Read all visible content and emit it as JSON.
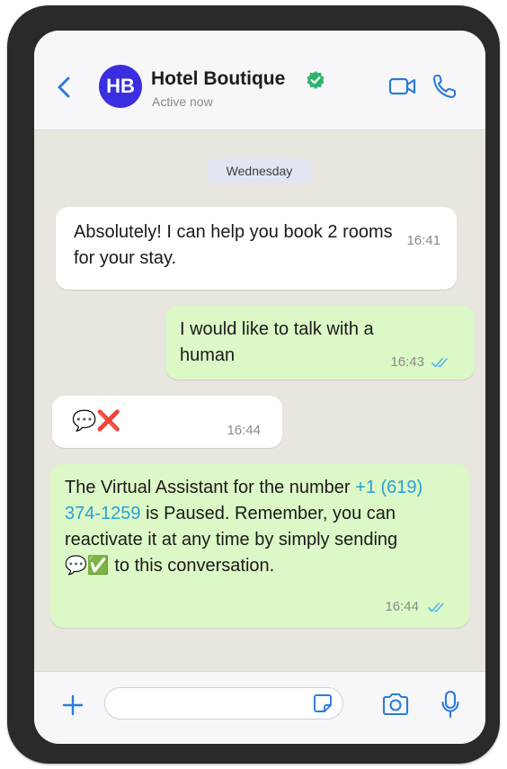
{
  "header": {
    "avatar_initials": "HB",
    "contact_name": "Hotel Boutique",
    "status": "Active now",
    "icons": {
      "back": "chevron-left-icon",
      "verified": "verified-check-icon",
      "video": "video-camera-icon",
      "call": "phone-icon"
    },
    "colors": {
      "accent": "#2b7bd9",
      "avatar_bg": "#3a2ee0",
      "verified": "#2fb46c"
    }
  },
  "chat": {
    "date_label": "Wednesday",
    "messages": [
      {
        "direction": "incoming",
        "text": "Absolutely! I can help you book 2 rooms for your stay.",
        "time": "16:41"
      },
      {
        "direction": "outgoing",
        "text": "I would like to talk with a human",
        "time": "16:43",
        "status": "read"
      },
      {
        "direction": "incoming",
        "text": "💬❌",
        "time": "16:44"
      },
      {
        "direction": "outgoing",
        "text_before": "The Virtual Assistant for the number",
        "phone_number": "+1 (619) 374-1259",
        "text_after": "is Paused. Remember, you can reactivate it at any time by simply sending 💬✅ to this conversation.",
        "time": "16:44",
        "status": "read"
      }
    ],
    "colors": {
      "incoming_bubble": "#ffffff",
      "outgoing_bubble": "#dcf8c6",
      "link": "#29a0d6",
      "read_ticks": "#4fb6e8"
    }
  },
  "composer": {
    "input_value": "",
    "icons": {
      "add": "plus-icon",
      "sticker": "sticker-icon",
      "camera": "camera-icon",
      "mic": "microphone-icon"
    }
  }
}
